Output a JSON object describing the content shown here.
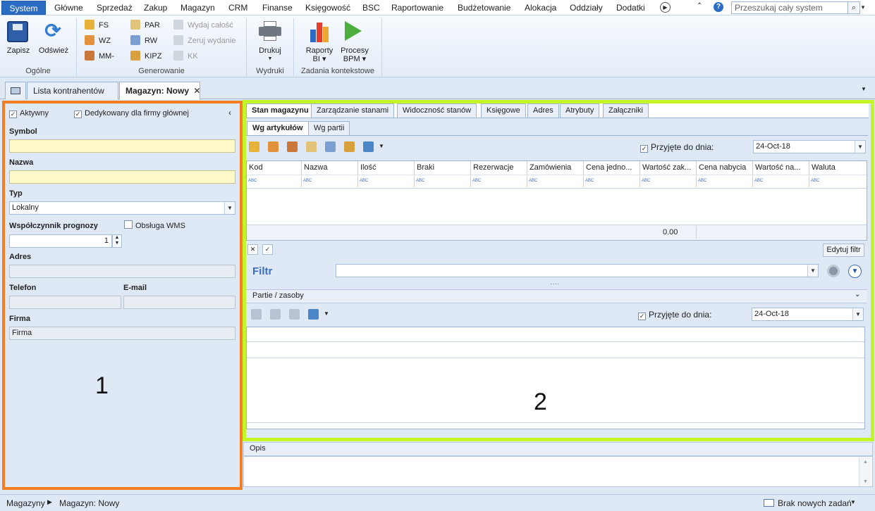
{
  "menu": {
    "system": "System",
    "items": [
      "Główne",
      "Sprzedaż",
      "Zakup",
      "Magazyn",
      "CRM",
      "Finanse",
      "Księgowość",
      "BSC",
      "Raportowanie",
      "Budżetowanie",
      "Alokacja",
      "Oddziały",
      "Dodatki"
    ],
    "search_placeholder": "Przeszukaj cały system"
  },
  "ribbon": {
    "save": "Zapisz",
    "refresh": "Odśwież",
    "group_general": "Ogólne",
    "fs": "FS",
    "wz": "WZ",
    "mm": "MM-",
    "par": "PAR",
    "rw": "RW",
    "kipz": "KIPZ",
    "issue_all": "Wydaj całość",
    "reset_issue": "Zeruj wydanie",
    "kk": "KK",
    "group_generate": "Generowanie",
    "print": "Drukuj",
    "group_prints": "Wydruki",
    "reports_line1": "Raporty",
    "reports_line2": "BI",
    "processes_line1": "Procesy",
    "processes_line2": "BPM",
    "group_context": "Zadania kontekstowe"
  },
  "doctabs": {
    "list": "Lista kontrahentów",
    "active": "Magazyn: Nowy"
  },
  "left": {
    "active_label": "Aktywny",
    "dedicated_label": "Dedykowany dla firmy głównej",
    "symbol_label": "Symbol",
    "symbol_value": "",
    "name_label": "Nazwa",
    "name_value": "",
    "type_label": "Typ",
    "type_value": "Lokalny",
    "forecast_label": "Współczynnik prognozy",
    "forecast_value": "1",
    "wms_label": "Obsługa WMS",
    "address_label": "Adres",
    "phone_label": "Telefon",
    "email_label": "E-mail",
    "company_label": "Firma",
    "company_value": "Firma",
    "annotation": "1"
  },
  "right": {
    "tabs": [
      "Stan magazynu",
      "Zarządzanie stanami",
      "Widoczność stanów",
      "Księgowe",
      "Adres",
      "Atrybuty",
      "Załączniki"
    ],
    "subtabs": [
      "Wg artykułów",
      "Wg partii"
    ],
    "accepted_label": "Przyjęte do dnia:",
    "date_value": "24-Oct-18",
    "columns": [
      "Kod",
      "Nazwa",
      "Ilość",
      "Braki",
      "Rezerwacje",
      "Zamówienia",
      "Cena jedno...",
      "Wartość zak...",
      "Cena nabycia",
      "Wartość na...",
      "Waluta"
    ],
    "filter_row_text": "ABC",
    "total_value": "0.00",
    "edit_filter": "Edytuj filtr",
    "filter_label": "Filtr",
    "batches_title": "Partie / zasoby",
    "batches_accepted_label": "Przyjęte do dnia:",
    "batches_date": "24-Oct-18",
    "annotation": "2"
  },
  "description": {
    "label": "Opis"
  },
  "status": {
    "crumb1": "Magazyny",
    "crumb2": "Magazyn: Nowy",
    "tasks": "Brak nowych zadań"
  }
}
